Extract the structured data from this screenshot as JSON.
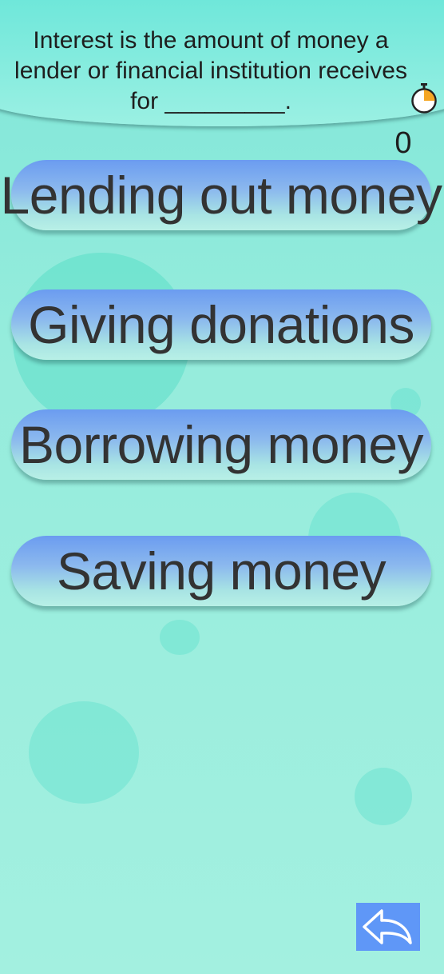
{
  "question": {
    "text": "Interest is the amount of money a lender or financial institution receives for _________."
  },
  "timer": {
    "icon": "stopwatch-icon",
    "accent_color": "#f5a623"
  },
  "score": {
    "value": "0"
  },
  "answers": [
    {
      "label": "Lending out money"
    },
    {
      "label": "Giving donations"
    },
    {
      "label": "Borrowing money"
    },
    {
      "label": "Saving money"
    }
  ],
  "back_button": {
    "icon": "back-arrow-icon",
    "color": "#5f97f7"
  }
}
